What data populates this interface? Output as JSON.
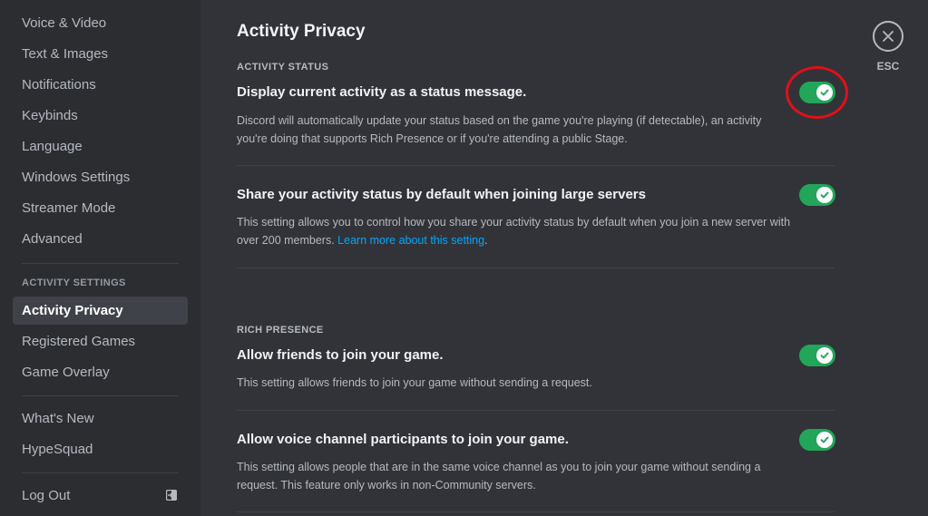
{
  "sidebar": {
    "items_top": [
      {
        "label": "Voice & Video"
      },
      {
        "label": "Text & Images"
      },
      {
        "label": "Notifications"
      },
      {
        "label": "Keybinds"
      },
      {
        "label": "Language"
      },
      {
        "label": "Windows Settings"
      },
      {
        "label": "Streamer Mode"
      },
      {
        "label": "Advanced"
      }
    ],
    "activity_header": "ACTIVITY SETTINGS",
    "activity_items": [
      {
        "label": "Activity Privacy",
        "active": true
      },
      {
        "label": "Registered Games"
      },
      {
        "label": "Game Overlay"
      }
    ],
    "misc_items": [
      {
        "label": "What's New"
      },
      {
        "label": "HypeSquad"
      }
    ],
    "logout_label": "Log Out"
  },
  "page": {
    "title": "Activity Privacy",
    "close_label": "ESC",
    "activity_status_header": "ACTIVITY STATUS",
    "rich_presence_header": "RICH PRESENCE",
    "settings": [
      {
        "title": "Display current activity as a status message.",
        "desc_line1": "Discord will automatically update your status based on the game you're playing (if detectable), an activity",
        "desc_line2": "you're doing that supports Rich Presence or if you're attending a public Stage.",
        "enabled": true
      },
      {
        "title": "Share your activity status by default when joining large servers",
        "desc_line1": "This setting allows you to control how you share your activity status by default when you join a new server with",
        "desc_line2_prefix": "over 200 members. ",
        "link_text": "Learn more about this setting",
        "desc_line2_suffix": ".",
        "enabled": true
      },
      {
        "title": "Allow friends to join your game.",
        "desc_line1": "This setting allows friends to join your game without sending a request.",
        "enabled": true
      },
      {
        "title": "Allow voice channel participants to join your game.",
        "desc_line1": "This setting allows people that are in the same voice channel as you to join your game without sending a",
        "desc_line2": "request. This feature only works in non-Community servers.",
        "enabled": true
      }
    ]
  },
  "colors": {
    "toggle_on": "#23a55a",
    "link": "#00a8fc",
    "highlight": "#e0101a"
  }
}
